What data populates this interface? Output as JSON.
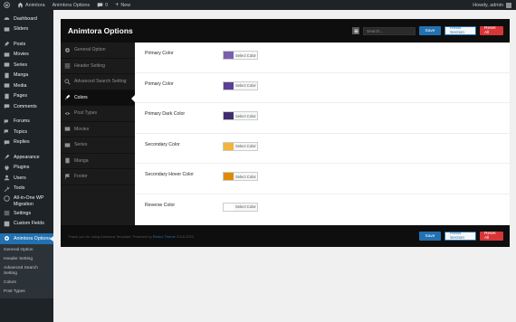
{
  "adminbar": {
    "site_name": "Animtora",
    "options_link": "Animtora Options",
    "comments_count": "0",
    "new_label": "New",
    "howdy": "Howdy, admin"
  },
  "sidebar": {
    "items": [
      {
        "label": "Dashboard",
        "icon": "dashboard-icon"
      },
      {
        "label": "Sliders",
        "icon": "slides-icon"
      },
      {
        "label": "Posts",
        "icon": "pin-icon"
      },
      {
        "label": "Movies",
        "icon": "film-icon"
      },
      {
        "label": "Series",
        "icon": "video-icon"
      },
      {
        "label": "Manga",
        "icon": "book-icon"
      },
      {
        "label": "Media",
        "icon": "media-icon"
      },
      {
        "label": "Pages",
        "icon": "page-icon"
      },
      {
        "label": "Comments",
        "icon": "comment-icon"
      },
      {
        "label": "Forums",
        "icon": "forum-icon"
      },
      {
        "label": "Topics",
        "icon": "topic-icon"
      },
      {
        "label": "Replies",
        "icon": "reply-icon"
      },
      {
        "label": "Appearance",
        "icon": "brush-icon"
      },
      {
        "label": "Plugins",
        "icon": "plugin-icon"
      },
      {
        "label": "Users",
        "icon": "user-icon"
      },
      {
        "label": "Tools",
        "icon": "wrench-icon"
      },
      {
        "label": "All-in-One WP Migration",
        "icon": "migration-icon"
      },
      {
        "label": "Settings",
        "icon": "settings-icon"
      },
      {
        "label": "Custom Fields",
        "icon": "fields-icon"
      }
    ],
    "active": {
      "label": "Animtora Options",
      "icon": "options-icon"
    },
    "submenu": [
      "General Option",
      "Header Setting",
      "Advanced Search Setting",
      "Colors",
      "Post Types"
    ]
  },
  "panel": {
    "title": "Animtora Options",
    "search_placeholder": "Search...",
    "save_label": "Save",
    "reset_section_label": "Reset Section",
    "reset_all_label": "Reset All",
    "nav": [
      {
        "label": "General Option",
        "icon": "gear-icon",
        "active": false
      },
      {
        "label": "Header Setting",
        "icon": "list-icon",
        "active": false
      },
      {
        "label": "Advanced Search Setting",
        "icon": "search-icon",
        "active": false
      },
      {
        "label": "Colors",
        "icon": "brush-icon",
        "active": true
      },
      {
        "label": "Post Types",
        "icon": "eye-icon",
        "active": false
      },
      {
        "label": "Movies",
        "icon": "film-icon",
        "active": false
      },
      {
        "label": "Series",
        "icon": "film-icon",
        "active": false
      },
      {
        "label": "Manga",
        "icon": "book-icon",
        "active": false
      },
      {
        "label": "Footer",
        "icon": "flag-icon",
        "active": false
      }
    ],
    "fields": [
      {
        "label": "Primary Color",
        "color": "#7b5fac",
        "button": "Select Color"
      },
      {
        "label": "Primary Color",
        "color": "#5b3f94",
        "button": "Select Color"
      },
      {
        "label": "Primary Dark Color",
        "color": "#3f2d6e",
        "button": "Select Color"
      },
      {
        "label": "Secondary Color",
        "color": "#f3b33d",
        "button": "Select Color"
      },
      {
        "label": "Secondary Hover Color",
        "color": "#e08a06",
        "button": "Select Color"
      },
      {
        "label": "Reverse Color",
        "color": "#ffffff",
        "button": "Select Color"
      }
    ],
    "footer": {
      "text": "Thank you for using Animtora Template. Powered by",
      "link": "Redux Theme",
      "version": "2018-2023"
    }
  }
}
